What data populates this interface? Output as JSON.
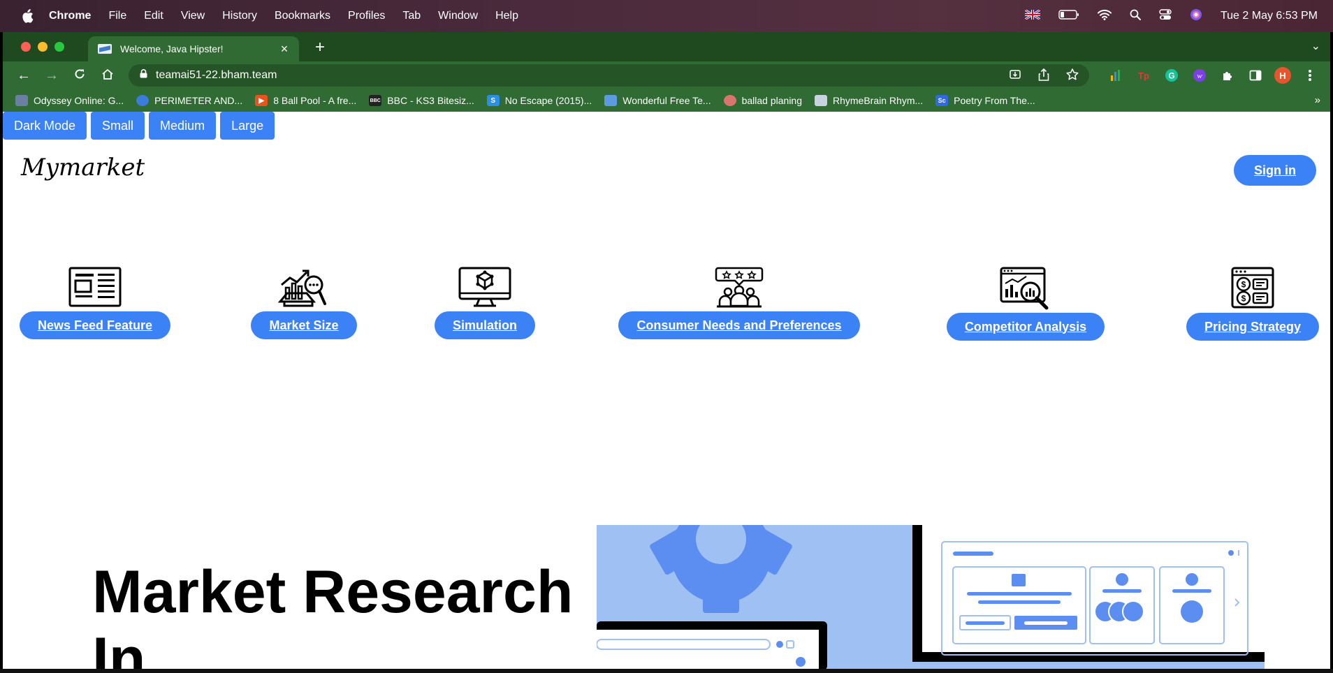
{
  "menubar": {
    "app_name": "Chrome",
    "items": [
      "File",
      "Edit",
      "View",
      "History",
      "Bookmarks",
      "Profiles",
      "Tab",
      "Window",
      "Help"
    ],
    "clock": "Tue 2 May  6:53 PM"
  },
  "browser": {
    "tab_title": "Welcome, Java Hipster!",
    "new_tab": "+",
    "url": "teamai51-22.bham.team",
    "profile_initial": "H",
    "bookmarks": [
      {
        "label": "Odyssey Online: G...",
        "icon": "shield-icon",
        "color": "#6b7fa3"
      },
      {
        "label": "PERIMETER AND...",
        "icon": "circle-icon",
        "color": "#3b7bd9"
      },
      {
        "label": "8 Ball Pool - A fre...",
        "icon": "play-icon",
        "color": "#e8541c"
      },
      {
        "label": "BBC - KS3 Bitesiz...",
        "icon": "bbc-icon",
        "color": "#222222"
      },
      {
        "label": "No Escape (2015)...",
        "icon": "s-icon",
        "color": "#2b8fe8"
      },
      {
        "label": "Wonderful Free Te...",
        "icon": "image-icon",
        "color": "#5c9be0"
      },
      {
        "label": "ballad planing",
        "icon": "fish-icon",
        "color": "#d9756a"
      },
      {
        "label": "RhymeBrain Rhym...",
        "icon": "page-icon",
        "color": "#c7d3e0"
      },
      {
        "label": "Poetry From The...",
        "icon": "sc-icon",
        "color": "#2f6ae0"
      }
    ],
    "bookmarks_more": "»"
  },
  "page": {
    "size_controls": [
      "Dark Mode",
      "Small",
      "Medium",
      "Large"
    ],
    "logo": "Mymarket",
    "sign_in": "Sign in",
    "features": [
      {
        "label": "News Feed Feature",
        "icon": "newspaper-icon"
      },
      {
        "label": "Market Size",
        "icon": "market-analysis-icon"
      },
      {
        "label": "Simulation",
        "icon": "monitor-cube-icon"
      },
      {
        "label": "Consumer Needs and Preferences",
        "icon": "customer-review-icon"
      },
      {
        "label": "Competitor Analysis",
        "icon": "chart-magnifier-icon"
      },
      {
        "label": "Pricing Strategy",
        "icon": "price-list-icon"
      }
    ],
    "hero_title": "Market Research In"
  },
  "colors": {
    "accent": "#3b82f6",
    "browser_frame": "#2f6b32",
    "tabstrip": "#1f4a20",
    "illustration_light": "#9ec0f3",
    "illustration_mid": "#5b8ef0"
  }
}
